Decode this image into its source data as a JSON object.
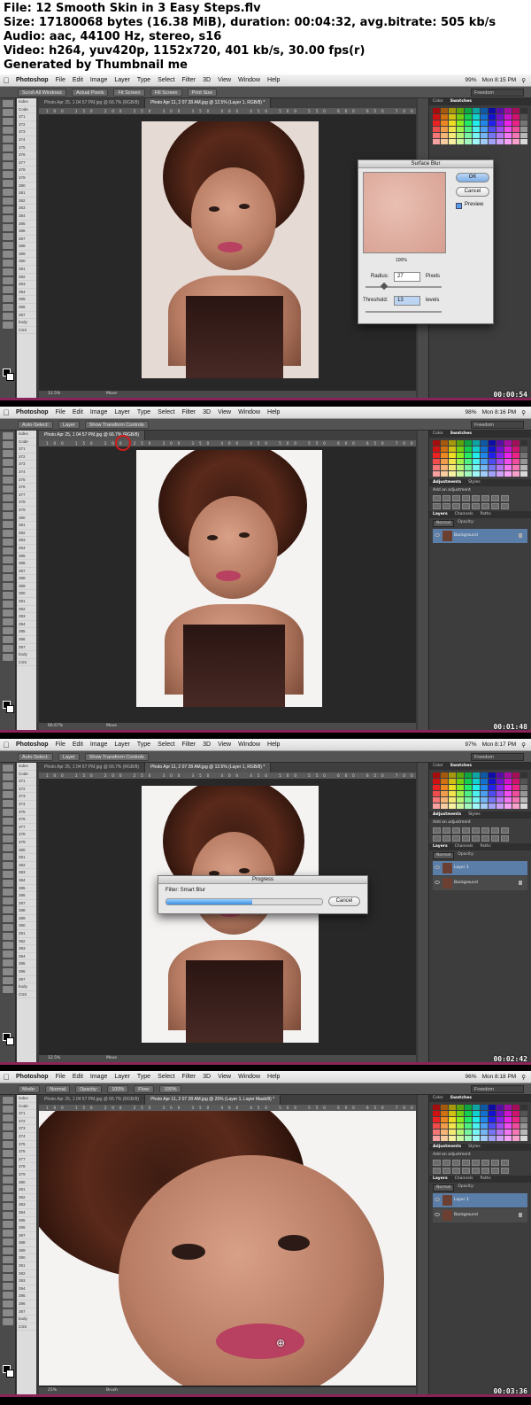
{
  "header": {
    "line1": "File: 12 Smooth Skin in 3 Easy Steps.flv",
    "line2": "Size: 17180068 bytes (16.38 MiB), duration: 00:04:32, avg.bitrate: 505 kb/s",
    "line3": "Audio: aac, 44100 Hz, stereo, s16",
    "line4": "Video: h264, yuv420p, 1152x720, 401 kb/s, 30.00 fps(r)",
    "line5": "Generated by Thumbnail me"
  },
  "menu": {
    "app": "Photoshop",
    "items": [
      "File",
      "Edit",
      "Image",
      "Layer",
      "Type",
      "Select",
      "Filter",
      "3D",
      "View",
      "Window",
      "Help"
    ]
  },
  "frames": [
    {
      "timestamp": "00:00:54",
      "clock": "Mon 8:15 PM",
      "battery": "99%",
      "workspace": "Freedom",
      "options": [
        "Scroll All Windows",
        "Actual Pixels",
        "Fit Screen",
        "Fill Screen",
        "Print Size"
      ],
      "tabs": [
        "Photo Apr 25, 1 04 57 PM.jpg @ 66.7% (RGB/8)",
        "Photo Apr 11, 2 07 28 AM.jpg @ 12.5% (Layer 1, RGB/8) *"
      ],
      "zoom": "12.5%",
      "status_tool": "Move",
      "panel_tabs": [
        "Color",
        "Swatches"
      ],
      "dialog": {
        "title": "Surface Blur",
        "ok": "OK",
        "cancel": "Cancel",
        "preview": "Preview",
        "zoom": "100%",
        "radius_label": "Radius:",
        "radius_value": "27",
        "radius_unit": "Pixels",
        "threshold_label": "Threshold:",
        "threshold_value": "13",
        "threshold_unit": "levels"
      }
    },
    {
      "timestamp": "00:01:48",
      "clock": "Mon 8:16 PM",
      "battery": "98%",
      "workspace": "Freedom",
      "options": [
        "Auto-Select:",
        "Layer",
        "Show Transform Controls"
      ],
      "tabs": [
        "Photo Apr 25, 1 04 57 PM.jpg @ 66.7% (RGB/8)"
      ],
      "zoom": "66.67%",
      "status_tool": "Move",
      "panel_tabs": [
        "Color",
        "Swatches"
      ],
      "adjustments": "Add an adjustment",
      "adjustments_tabs": [
        "Adjustments",
        "Styles"
      ],
      "layers_tabs": [
        "Layers",
        "Channels",
        "Paths"
      ],
      "blend": "Normal",
      "opacity": "Opacity:",
      "layers": [
        "Background"
      ]
    },
    {
      "timestamp": "00:02:42",
      "clock": "Mon 8:17 PM",
      "battery": "97%",
      "workspace": "Freedom",
      "options": [
        "Auto-Select:",
        "Layer",
        "Show Transform Controls"
      ],
      "tabs": [
        "Photo Apr 25, 1 04 57 PM.jpg @ 66.7% (RGB/8)",
        "Photo Apr 11, 2 07 28 AM.jpg @ 12.5% (Layer 1, RGB/8) *"
      ],
      "zoom": "12.5%",
      "status_tool": "Move",
      "panel_tabs": [
        "Color",
        "Swatches"
      ],
      "adjustments": "Add an adjustment",
      "adjustments_tabs": [
        "Adjustments",
        "Styles"
      ],
      "layers_tabs": [
        "Layers",
        "Channels",
        "Paths"
      ],
      "blend": "Normal",
      "opacity": "Opacity:",
      "layers": [
        "Layer 1",
        "Background"
      ],
      "progress": {
        "title": "Progress",
        "filter": "Filter: Smart Blur",
        "cancel": "Cancel",
        "fraction": 0.55
      }
    },
    {
      "timestamp": "00:03:36",
      "clock": "Mon 8:18 PM",
      "battery": "96%",
      "workspace": "Freedom",
      "options": [
        "Mode:",
        "Normal",
        "Opacity:",
        "100%",
        "Flow:",
        "100%"
      ],
      "tabs": [
        "Photo Apr 25, 1 04 57 PM.jpg @ 66.7% (RGB/8)",
        "Photo Apr 11, 2 07 28 AM.jpg @ 25% (Layer 1, Layer Mask/8) *"
      ],
      "zoom": "25%",
      "status_tool": "Brush",
      "panel_tabs": [
        "Color",
        "Swatches"
      ],
      "adjustments": "Add an adjustment",
      "adjustments_tabs": [
        "Adjustments",
        "Styles"
      ],
      "layers_tabs": [
        "Layers",
        "Channels",
        "Paths"
      ],
      "blend": "Normal",
      "opacity": "Opacity:",
      "layers": [
        "Layer 1",
        "Background"
      ]
    }
  ],
  "finder_items": [
    "index",
    "Code",
    "371",
    "372",
    "373",
    "374",
    "375",
    "376",
    "377",
    "378",
    "379",
    "380",
    "381",
    "382",
    "383",
    "384",
    "385",
    "386",
    "387",
    "388",
    "389",
    "390",
    "391",
    "392",
    "393",
    "394",
    "395",
    "396",
    "397",
    "body",
    "CSS"
  ],
  "ruler_text": "100 150 200 250 300 350 400 450 500 550 600 650 700 750 800",
  "colors": {
    "menubar": "#e0e0e0",
    "panel": "#3d3d3d",
    "selected_layer": "#5b7ea8",
    "dock_accent": "#8a2458",
    "highlight_circle": "#d21a1a"
  }
}
